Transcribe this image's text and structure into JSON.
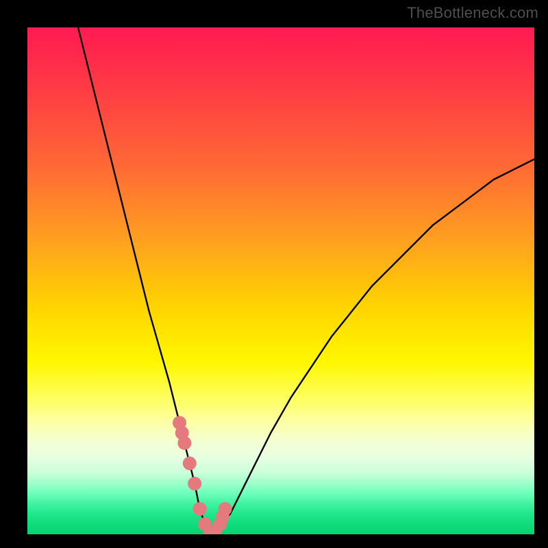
{
  "watermark": "TheBottleneck.com",
  "colors": {
    "frame": "#000000",
    "curve": "#000000",
    "marker": "#e47a7d",
    "gradient_top": "#ff1a52",
    "gradient_bottom": "#06d270"
  },
  "chart_data": {
    "type": "line",
    "title": "",
    "xlabel": "",
    "ylabel": "",
    "xlim": [
      0,
      100
    ],
    "ylim": [
      0,
      100
    ],
    "grid": false,
    "legend": false,
    "series": [
      {
        "name": "bottleneck-curve",
        "x": [
          10,
          12,
          14,
          16,
          18,
          20,
          22,
          24,
          26,
          28,
          30,
          31,
          32,
          33,
          34,
          35,
          36,
          37,
          38,
          40,
          42,
          44,
          46,
          48,
          52,
          56,
          60,
          64,
          68,
          72,
          76,
          80,
          84,
          88,
          92,
          96,
          100
        ],
        "y": [
          100,
          92,
          84,
          76,
          68,
          60,
          52,
          44,
          37,
          30,
          22,
          18,
          14,
          10,
          5,
          2,
          0,
          0.5,
          2,
          4,
          8,
          12,
          16,
          20,
          27,
          33,
          39,
          44,
          49,
          53,
          57,
          61,
          64,
          67,
          70,
          72,
          74
        ]
      }
    ],
    "markers": {
      "name": "highlighted-range",
      "x": [
        30,
        30.5,
        31,
        32,
        33,
        34,
        35,
        36,
        37,
        38,
        38.5,
        39
      ],
      "y": [
        22,
        20,
        18,
        14,
        10,
        5,
        2,
        0,
        0.5,
        2,
        3.5,
        5
      ]
    }
  }
}
